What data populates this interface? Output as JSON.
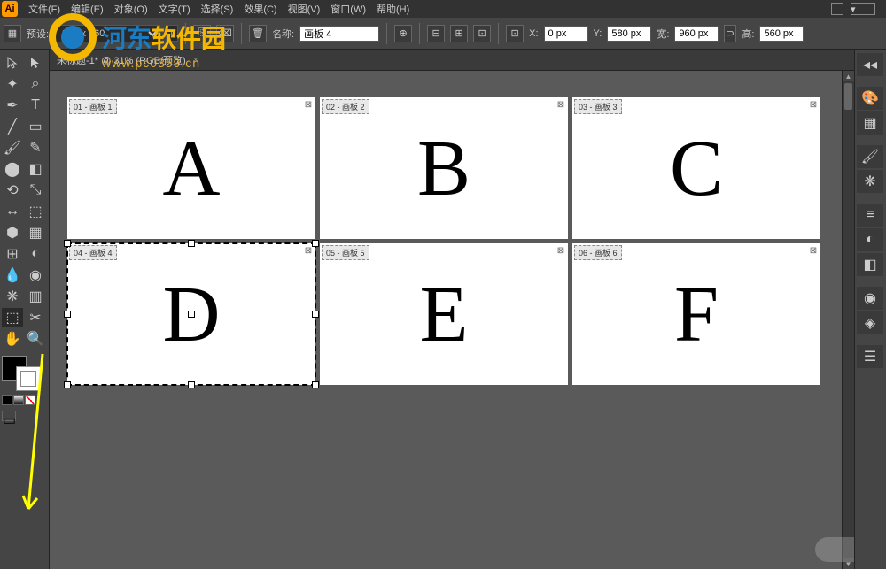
{
  "menubar": {
    "items": [
      "文件(F)",
      "编辑(E)",
      "对象(O)",
      "文字(T)",
      "选择(S)",
      "效果(C)",
      "视图(V)",
      "窗口(W)",
      "帮助(H)"
    ],
    "logo": "Ai"
  },
  "options": {
    "preset_label": "预设:",
    "preset_value": "960 x 560",
    "name_label": "名称:",
    "name_value": "画板 4",
    "x_label": "X:",
    "x_value": "0 px",
    "y_label": "Y:",
    "y_value": "580 px",
    "w_label": "宽:",
    "w_value": "960 px",
    "h_label": "高:",
    "h_value": "560 px"
  },
  "document": {
    "tab_title": "未标题-1* @ 31% (RGB/预览)"
  },
  "artboards": [
    {
      "label": "01 - 画板 1",
      "letter": "A",
      "selected": false
    },
    {
      "label": "02 - 画板 2",
      "letter": "B",
      "selected": false
    },
    {
      "label": "03 - 画板 3",
      "letter": "C",
      "selected": false
    },
    {
      "label": "04 - 画板 4",
      "letter": "D",
      "selected": true
    },
    {
      "label": "05 - 画板 5",
      "letter": "E",
      "selected": false
    },
    {
      "label": "06 - 画板 6",
      "letter": "F",
      "selected": false
    }
  ],
  "watermark": {
    "text1": "河东",
    "text2": "软件园",
    "url": "www.pc0359.cn"
  },
  "tools": [
    [
      "selection-tool",
      "direct-selection-tool"
    ],
    [
      "magic-wand-tool",
      "lasso-tool"
    ],
    [
      "pen-tool",
      "type-tool"
    ],
    [
      "line-tool",
      "rectangle-tool"
    ],
    [
      "paintbrush-tool",
      "pencil-tool"
    ],
    [
      "blob-brush-tool",
      "eraser-tool"
    ],
    [
      "rotate-tool",
      "scale-tool"
    ],
    [
      "width-tool",
      "free-transform-tool"
    ],
    [
      "shape-builder-tool",
      "perspective-grid-tool"
    ],
    [
      "mesh-tool",
      "gradient-tool"
    ],
    [
      "eyedropper-tool",
      "blend-tool"
    ],
    [
      "symbol-sprayer-tool",
      "column-graph-tool"
    ],
    [
      "artboard-tool",
      "slice-tool"
    ],
    [
      "hand-tool",
      "zoom-tool"
    ]
  ],
  "active_tool": "artboard-tool",
  "panels": [
    "collapse-icon",
    "color-panel",
    "swatches-panel",
    "brushes-panel",
    "symbols-panel",
    "stroke-panel",
    "gradient-panel",
    "transparency-panel",
    "appearance-panel",
    "graphic-styles-panel",
    "layers-panel"
  ]
}
